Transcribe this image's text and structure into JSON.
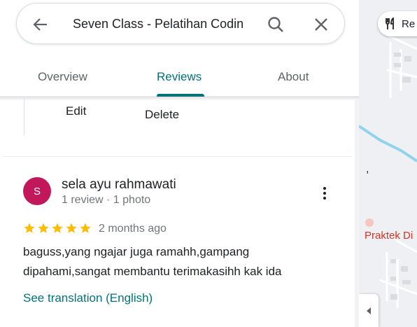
{
  "search": {
    "query": "Seven Class - Pelatihan Codin"
  },
  "tabs": [
    {
      "label": "Overview",
      "active": false
    },
    {
      "label": "Reviews",
      "active": true
    },
    {
      "label": "About",
      "active": false
    }
  ],
  "context_menu": {
    "edit_label": "Edit",
    "delete_label": "Delete"
  },
  "review": {
    "avatar_initial": "S",
    "avatar_color": "#c2185b",
    "reviewer_name": "sela ayu rahmawati",
    "reviewer_meta": "1 review · 1 photo",
    "rating": 5,
    "date": "2 months ago",
    "text_line1": "baguss,yang ngajar juga ramahh,gampang",
    "text_line2": "dipahami,sangat membantu terimakasihh kak ida",
    "translate_label": "See translation (English)"
  },
  "map": {
    "category_chip": "Re",
    "place_label": "Praktek Di",
    "mark": ","
  },
  "colors": {
    "accent": "#00737a",
    "star": "#fbbc04",
    "map_label": "#d93025"
  }
}
